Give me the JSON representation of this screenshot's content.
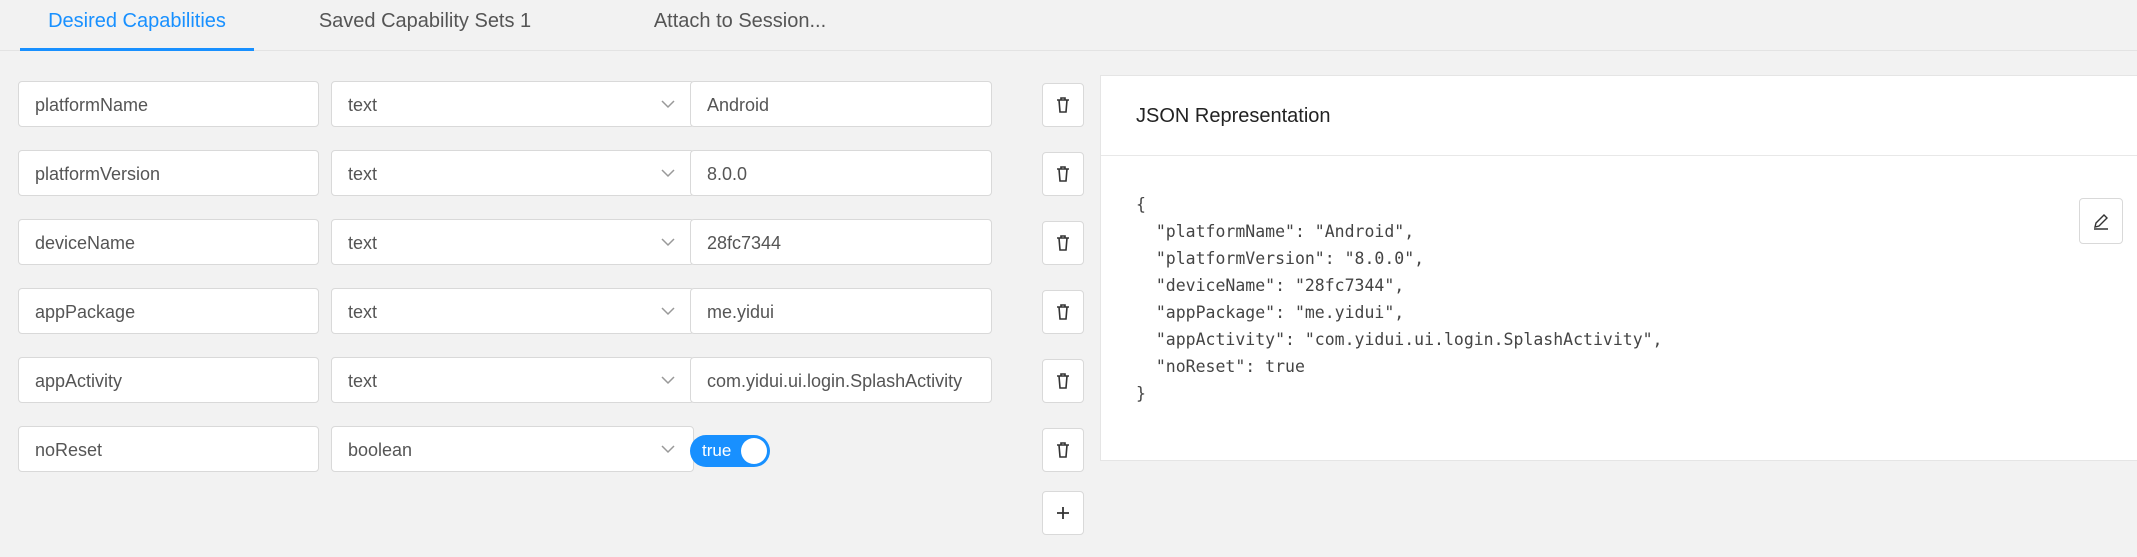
{
  "tabs": [
    {
      "label": "Desired Capabilities",
      "active": true
    },
    {
      "label": "Saved Capability Sets 1",
      "active": false
    },
    {
      "label": "Attach to Session...",
      "active": false
    }
  ],
  "capabilities": [
    {
      "name": "platformName",
      "type": "text",
      "value": "Android"
    },
    {
      "name": "platformVersion",
      "type": "text",
      "value": "8.0.0"
    },
    {
      "name": "deviceName",
      "type": "text",
      "value": "28fc7344"
    },
    {
      "name": "appPackage",
      "type": "text",
      "value": "me.yidui"
    },
    {
      "name": "appActivity",
      "type": "text",
      "value": "com.yidui.ui.login.SplashActivity"
    },
    {
      "name": "noReset",
      "type": "boolean",
      "value": "true"
    }
  ],
  "json_panel": {
    "title": "JSON Representation",
    "lines": [
      "{",
      "  \"platformName\": \"Android\",",
      "  \"platformVersion\": \"8.0.0\",",
      "  \"deviceName\": \"28fc7344\",",
      "  \"appPackage\": \"me.yidui\",",
      "  \"appActivity\": \"com.yidui.ui.login.SplashActivity\",",
      "  \"noReset\": true",
      "}"
    ]
  },
  "icons": {
    "delete": "trash-icon",
    "add": "plus-icon",
    "edit": "edit-icon",
    "dropdown": "chevron-down-icon"
  },
  "colors": {
    "accent": "#1890ff",
    "background": "#f2f2f2",
    "panel": "#ffffff",
    "border": "#d9d9d9"
  }
}
